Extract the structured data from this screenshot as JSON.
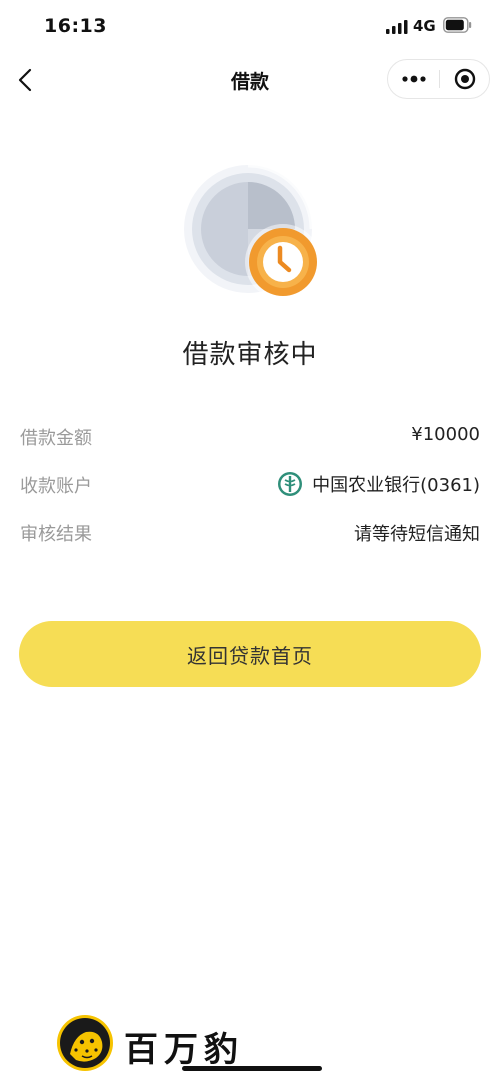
{
  "status_bar": {
    "time": "16:13",
    "network": "4G"
  },
  "nav": {
    "title": "借款"
  },
  "status": {
    "title": "借款审核中"
  },
  "info_rows": [
    {
      "label": "借款金额",
      "value": "¥10000"
    },
    {
      "label": "收款账户",
      "value": "中国农业银行(0361)"
    },
    {
      "label": "审核结果",
      "value": "请等待短信通知"
    }
  ],
  "actions": {
    "primary": "返回贷款首页"
  },
  "brand": {
    "name": "百万豹"
  },
  "colors": {
    "accent": "#f6dd55",
    "clock": "#f19a2e",
    "bank_green": "#2f8f7a"
  },
  "icons": {
    "back": "chevron-left-icon",
    "more": "more-dots-icon",
    "close": "target-circle-icon",
    "status": "clock-icon",
    "bank": "abc-bank-logo-icon"
  }
}
